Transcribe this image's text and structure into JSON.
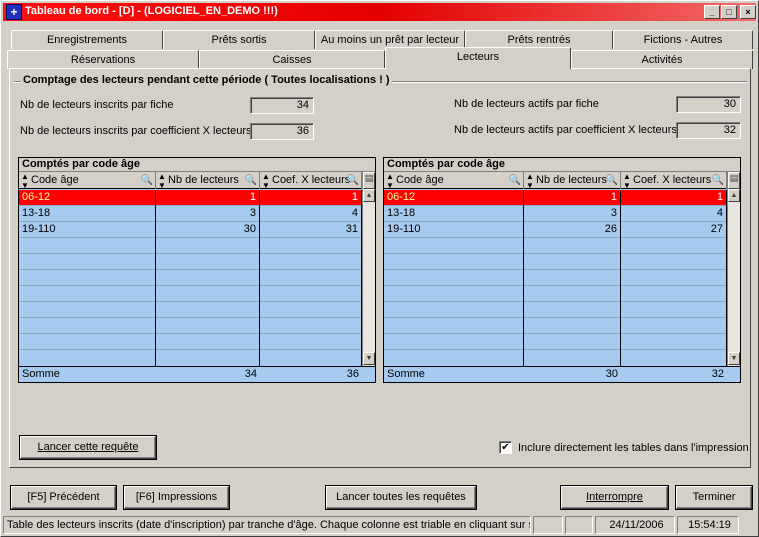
{
  "window": {
    "title": "Tableau de bord  - [D] - (LOGICIEL_EN_DEMO !!!)",
    "minimize": "_",
    "maximize": "□",
    "close": "×",
    "title_color": "#ff0000"
  },
  "tabs": {
    "row1": [
      "Enregistrements",
      "Prêts sortis",
      "Au moins un prêt par lecteur",
      "Prêts rentrés",
      "Fictions - Autres"
    ],
    "row2": [
      "Réservations",
      "Caisses",
      "Lecteurs",
      "Activités"
    ],
    "active": "Lecteurs"
  },
  "group": {
    "title": "Comptage des lecteurs pendant cette période ( Toutes localisations ! )"
  },
  "stats": {
    "inscrits_fiche_label": "Nb de lecteurs inscrits par fiche",
    "inscrits_fiche_value": "34",
    "inscrits_coef_label": "Nb de lecteurs inscrits par coefficient X lecteurs",
    "inscrits_coef_value": "36",
    "actifs_fiche_label": "Nb de lecteurs actifs par fiche",
    "actifs_fiche_value": "30",
    "actifs_coef_label": "Nb de lecteurs actifs par coefficient X lecteurs",
    "actifs_coef_value": "32"
  },
  "left_table": {
    "caption": "Comptés par code âge",
    "columns": [
      "Code âge",
      "Nb de lecteurs",
      "Coef. X lecteurs"
    ],
    "rows": [
      [
        "06-12",
        "1",
        "1"
      ],
      [
        "13-18",
        "3",
        "4"
      ],
      [
        "19-110",
        "30",
        "31"
      ]
    ],
    "sum_label": "Somme",
    "sum_values": [
      "34",
      "36"
    ]
  },
  "right_table": {
    "caption": "Comptés par code âge",
    "columns": [
      "Code âge",
      "Nb de lecteurs",
      "Coef. X lecteurs"
    ],
    "rows": [
      [
        "06-12",
        "1",
        "1"
      ],
      [
        "13-18",
        "3",
        "4"
      ],
      [
        "19-110",
        "26",
        "27"
      ]
    ],
    "sum_label": "Somme",
    "sum_values": [
      "30",
      "32"
    ]
  },
  "actions": {
    "launch_query": "Lancer cette requête",
    "include_tables": "Inclure directement les tables dans l'impression",
    "include_checked": "✔"
  },
  "bottom_buttons": {
    "previous": "[F5] Précédent",
    "prints": "[F6] Impressions",
    "launch_all": "Lancer toutes les requêtes",
    "interrupt": "Interrompre",
    "finish": "Terminer"
  },
  "statusbar": {
    "message": "Table des lecteurs inscrits (date d'inscription) par tranche d'âge. Chaque colonne est triable en cliquant sur son",
    "date": "24/11/2006",
    "time": "15:54:19"
  },
  "colors": {
    "selected_row": "#ff0000",
    "grid_bg": "#a6caf0",
    "face": "#d4d0c8"
  }
}
